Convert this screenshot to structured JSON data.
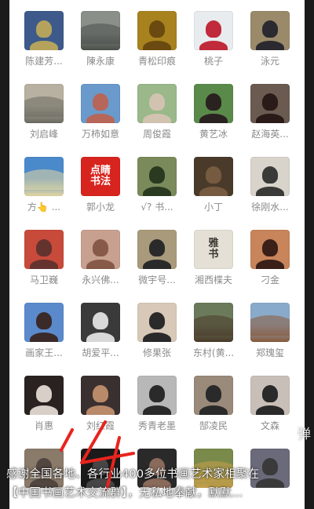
{
  "members": [
    {
      "name": "陈建芳...",
      "bg": "#3d5a8a",
      "accent": "#e8c24a",
      "img": "photo"
    },
    {
      "name": "陳永康",
      "bg": "#8a8f8a",
      "accent": "#4a4f4a",
      "img": "landscape"
    },
    {
      "name": "青松印痕",
      "bg": "#a8821e",
      "accent": "#6a4a10",
      "img": "seal"
    },
    {
      "name": "桃子",
      "bg": "#e8ecee",
      "accent": "#c02a3a",
      "img": "portrait"
    },
    {
      "name": "泳元",
      "bg": "#9a8a6a",
      "accent": "#2a2a30",
      "img": "portrait"
    },
    {
      "name": "刘启峰",
      "bg": "#b8b0a0",
      "accent": "#6a6a60",
      "img": "landscape"
    },
    {
      "name": "万柿如意",
      "bg": "#6a9acb",
      "accent": "#d8502a",
      "img": "photo"
    },
    {
      "name": "周俊霞",
      "bg": "#9ab88a",
      "accent": "#e8c8c0",
      "img": "photo"
    },
    {
      "name": "黄艺冰",
      "bg": "#5a8a4a",
      "accent": "#2a2220",
      "img": "portrait"
    },
    {
      "name": "赵海英...",
      "bg": "#6a5a50",
      "accent": "#2a1a18",
      "img": "portrait"
    },
    {
      "name": "方👆 ...",
      "bg": "#4a8acb",
      "accent": "#e8d8a0",
      "img": "landscape"
    },
    {
      "name": "郭小龙",
      "bg": "#d8241e",
      "accent": "#ffffff",
      "img": "text",
      "text": "点睛\n书法"
    },
    {
      "name": "√? 书...",
      "bg": "#7a8a5a",
      "accent": "#2a3a20",
      "img": "portrait"
    },
    {
      "name": "小丁",
      "bg": "#4a3a2a",
      "accent": "#8a6a4a",
      "img": "photo"
    },
    {
      "name": "徐刚水...",
      "bg": "#d8d4cc",
      "accent": "#3a3a38",
      "img": "portrait"
    },
    {
      "name": "马卫巍",
      "bg": "#c84a3a",
      "accent": "#3a2a2a",
      "img": "photo"
    },
    {
      "name": "永兴佛...",
      "bg": "#c8a090",
      "accent": "#6a3a2a",
      "img": "photo"
    },
    {
      "name": "微宇号...",
      "bg": "#a89a7a",
      "accent": "#2a2a2a",
      "img": "portrait"
    },
    {
      "name": "湘西楪夫",
      "bg": "#e4e0d6",
      "accent": "#3a3530",
      "img": "text",
      "text": "雅\n书"
    },
    {
      "name": "刁金",
      "bg": "#c8845a",
      "accent": "#3a2018",
      "img": "portrait"
    },
    {
      "name": "画家王...",
      "bg": "#5a8acb",
      "accent": "#3a2a2a",
      "img": "portrait"
    },
    {
      "name": "胡爱平...",
      "bg": "#3a3a3a",
      "accent": "#d8d8d8",
      "img": "portrait"
    },
    {
      "name": "修果张",
      "bg": "#d8c8b8",
      "accent": "#2a2a2a",
      "img": "portrait"
    },
    {
      "name": "东村(黄...",
      "bg": "#6a7a5a",
      "accent": "#4a3a2a",
      "img": "landscape"
    },
    {
      "name": "郑瑰玺",
      "bg": "#8aaacb",
      "accent": "#8a5a3a",
      "img": "landscape"
    },
    {
      "name": "肖惠",
      "bg": "#2a2220",
      "accent": "#d8d0c8",
      "img": "portrait"
    },
    {
      "name": "刘红霞",
      "bg": "#3a3030",
      "accent": "#b88a6a",
      "img": "portrait"
    },
    {
      "name": "秀青老墨",
      "bg": "#b8b8b8",
      "accent": "#2a2a2a",
      "img": "portrait"
    },
    {
      "name": "郜凌民",
      "bg": "#9a8a7a",
      "accent": "#2a2a2a",
      "img": "portrait"
    },
    {
      "name": "文森",
      "bg": "#c8c0b8",
      "accent": "#2a2a2a",
      "img": "portrait"
    },
    {
      "name": "",
      "bg": "#8a7a6a",
      "accent": "#3a3030",
      "img": "photo"
    },
    {
      "name": "",
      "bg": "#1a1a1a",
      "accent": "#5a5a5a",
      "img": "photo"
    },
    {
      "name": "",
      "bg": "#2a2a2a",
      "accent": "#8a6a5a",
      "img": "portrait"
    },
    {
      "name": "",
      "bg": "#7a8a4a",
      "accent": "#c8a04a",
      "img": "landscape"
    },
    {
      "name": "",
      "bg": "#6a6a7a",
      "accent": "#3a3a3a",
      "img": "portrait"
    }
  ],
  "danmaku_label": "弹",
  "caption": {
    "line1": "感谢全国各地、各行业400多位书画艺术家相聚在",
    "line2": "【中国书画艺术交流群】，无私地奉献，默默..."
  },
  "colors": {
    "panel": "#ffffff",
    "backdrop": "#1a1a1a",
    "name_text": "#8a8a8a",
    "scribble": "#e8241e"
  }
}
